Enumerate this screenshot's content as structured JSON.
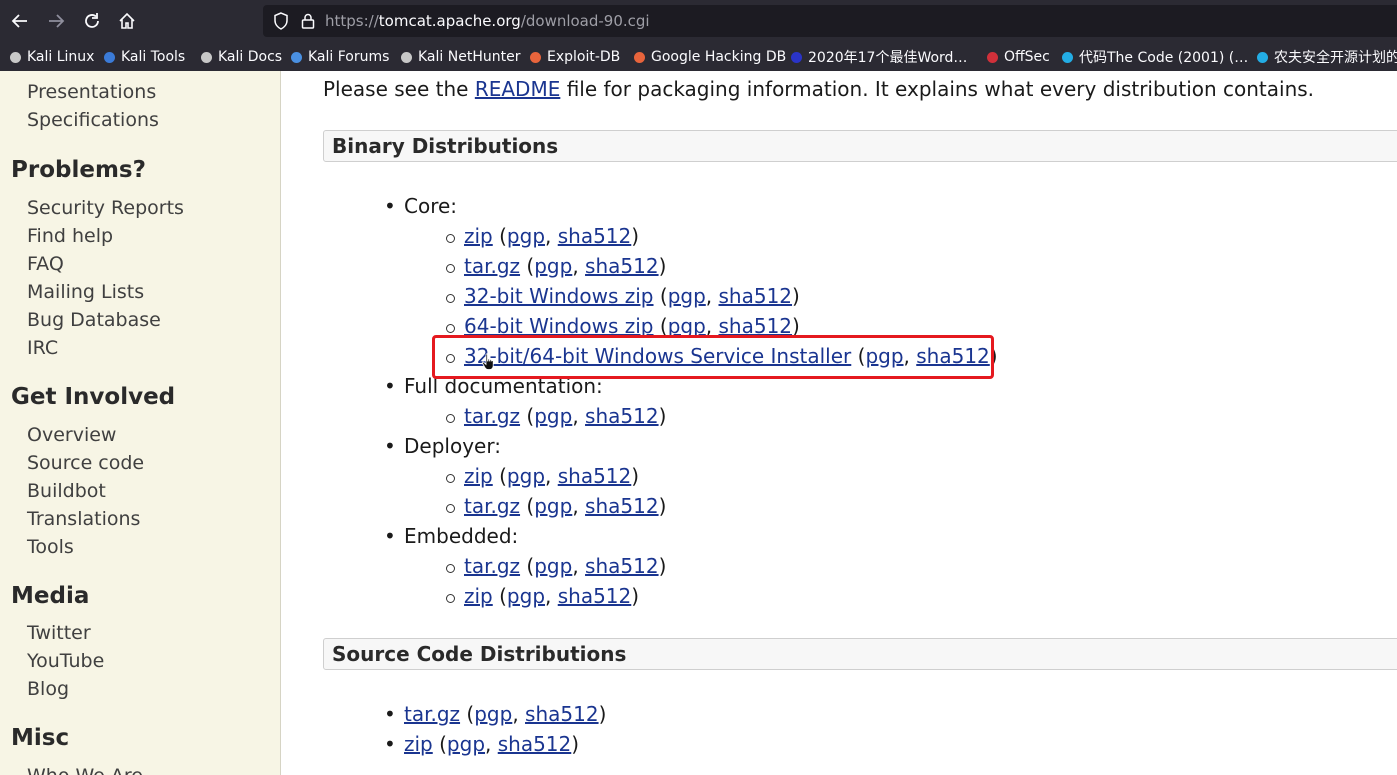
{
  "browser": {
    "url_prefix": "https://",
    "url_host": "tomcat.apache.org",
    "url_path": "/download-90.cgi",
    "bookmarks": [
      {
        "label": "Kali Linux",
        "icon": "kali-dragon-icon"
      },
      {
        "label": "Kali Tools",
        "icon": "kali-tools-icon"
      },
      {
        "label": "Kali Docs",
        "icon": "kali-dragon-icon"
      },
      {
        "label": "Kali Forums",
        "icon": "kali-forums-icon"
      },
      {
        "label": "Kali NetHunter",
        "icon": "kali-dragon-icon"
      },
      {
        "label": "Exploit-DB",
        "icon": "exploit-db-icon"
      },
      {
        "label": "Google Hacking DB",
        "icon": "exploit-db-icon"
      },
      {
        "label": "2020年17个最佳Word…",
        "icon": "bookmark-icon"
      },
      {
        "label": "OffSec",
        "icon": "offsec-icon"
      },
      {
        "label": "代码The Code (2001) (…",
        "icon": "bilibili-icon"
      },
      {
        "label": "农夫安全开源计划的",
        "icon": "bilibili-icon"
      }
    ]
  },
  "sidebar": {
    "items_top": [
      "Presentations",
      "Specifications"
    ],
    "sections": [
      {
        "title": "Problems?",
        "items": [
          "Security Reports",
          "Find help",
          "FAQ",
          "Mailing Lists",
          "Bug Database",
          "IRC"
        ]
      },
      {
        "title": "Get Involved",
        "items": [
          "Overview",
          "Source code",
          "Buildbot",
          "Translations",
          "Tools"
        ]
      },
      {
        "title": "Media",
        "items": [
          "Twitter",
          "YouTube",
          "Blog"
        ]
      },
      {
        "title": "Misc",
        "items": [
          "Who We Are"
        ]
      }
    ]
  },
  "content": {
    "intro_before": "Please see the ",
    "intro_link": "README",
    "intro_after": " file for packaging information. It explains what every distribution contains.",
    "binary_title": "Binary Distributions",
    "source_title": "Source Code Distributions",
    "groups": [
      {
        "label": "Core:",
        "items": [
          "zip",
          "tar.gz",
          "32-bit Windows zip",
          "64-bit Windows zip",
          "32-bit/64-bit Windows Service Installer"
        ]
      },
      {
        "label": "Full documentation:",
        "items": [
          "tar.gz"
        ]
      },
      {
        "label": "Deployer:",
        "items": [
          "zip",
          "tar.gz"
        ]
      },
      {
        "label": "Embedded:",
        "items": [
          "tar.gz",
          "zip"
        ]
      }
    ],
    "source_items": [
      "tar.gz",
      "zip"
    ],
    "pgp": "pgp",
    "sha": "sha512",
    "open_paren": " (",
    "comma": ", ",
    "close_paren": ")"
  },
  "colors": {
    "link": "#1a3590",
    "highlight": "#e5191f",
    "sidebar_bg": "#f7f5e5",
    "toolbar_bg": "#2b2a33"
  }
}
